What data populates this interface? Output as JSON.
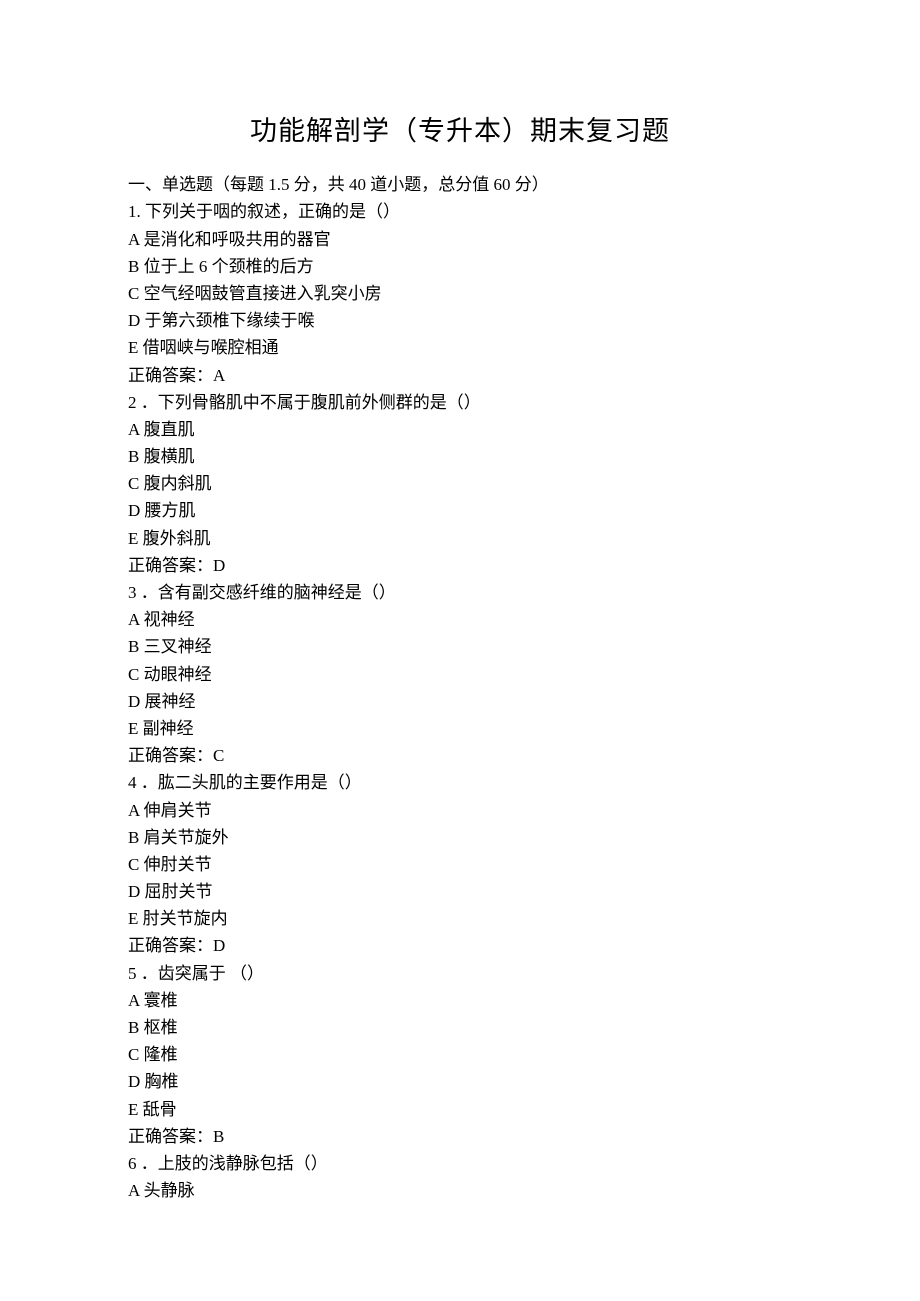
{
  "title": "功能解剖学（专升本）期末复习题",
  "section_header": "一、单选题（每题 1.5 分，共 40 道小题，总分值 60 分）",
  "questions": [
    {
      "number": "1.",
      "text": "下列关于咽的叙述，正确的是（）",
      "options": [
        "A 是消化和呼吸共用的器官",
        "B 位于上 6 个颈椎的后方",
        "C 空气经咽鼓管直接进入乳突小房",
        "D 于第六颈椎下缘续于喉",
        "E 借咽峡与喉腔相通"
      ],
      "answer": "正确答案：A"
    },
    {
      "number": "2",
      "text": "．下列骨骼肌中不属于腹肌前外侧群的是（）",
      "options": [
        "A 腹直肌",
        "B 腹横肌",
        "C 腹内斜肌",
        "D 腰方肌",
        "E 腹外斜肌"
      ],
      "answer": "正确答案：D"
    },
    {
      "number": "3",
      "text": "．含有副交感纤维的脑神经是（）",
      "options": [
        "A 视神经",
        "B 三叉神经",
        "C 动眼神经",
        "D 展神经",
        "E 副神经"
      ],
      "answer": "正确答案：C"
    },
    {
      "number": "4",
      "text": "．肱二头肌的主要作用是（）",
      "options": [
        "A 伸肩关节",
        "B 肩关节旋外",
        "C 伸肘关节",
        "D 屈肘关节",
        "E 肘关节旋内"
      ],
      "answer": "正确答案：D"
    },
    {
      "number": "5",
      "text": "．齿突属于 （）",
      "options": [
        "A 寰椎",
        "B 枢椎",
        "C 隆椎",
        "D 胸椎",
        "E 舐骨"
      ],
      "answer": "正确答案：B"
    },
    {
      "number": "6",
      "text": "．上肢的浅静脉包括（）",
      "options": [
        "A 头静脉"
      ],
      "answer": null
    }
  ]
}
